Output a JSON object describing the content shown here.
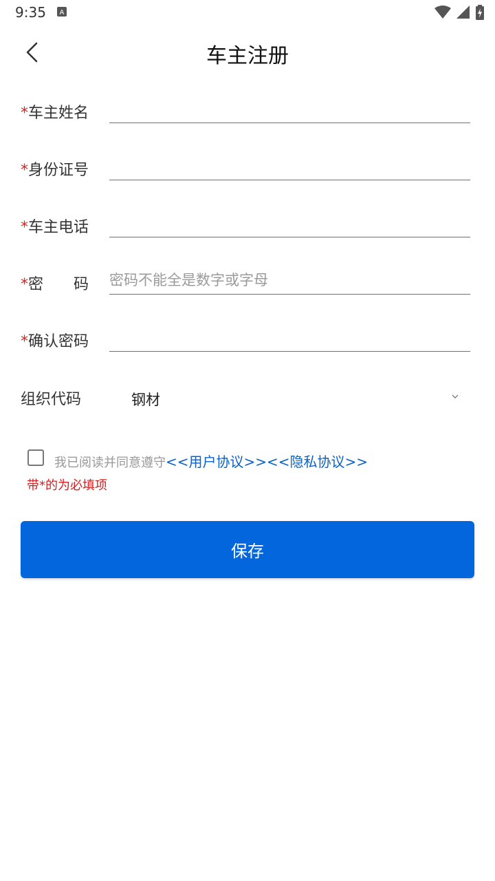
{
  "status_bar": {
    "time": "9:35"
  },
  "header": {
    "title": "车主注册",
    "back_icon": "chevron-left-icon"
  },
  "form": {
    "required_mark": "*",
    "fields": [
      {
        "label": "车主姓名",
        "value": "",
        "placeholder": ""
      },
      {
        "label": "身份证号",
        "value": "",
        "placeholder": ""
      },
      {
        "label": "车主电话",
        "value": "",
        "placeholder": ""
      },
      {
        "label": "密　　码",
        "value": "",
        "placeholder": "密码不能全是数字或字母"
      },
      {
        "label": "确认密码",
        "value": "",
        "placeholder": ""
      }
    ],
    "org_code": {
      "label": "组织代码",
      "value": "钢材"
    }
  },
  "agreement": {
    "text": "我已阅读并同意遵守",
    "user_link": "<<用户协议>>",
    "privacy_link": "<<隐私协议>>",
    "checked": false
  },
  "required_note": "带*的为必填项",
  "save_label": "保存",
  "colors": {
    "accent": "#0466dd",
    "link": "#0b62c4",
    "required": "#e02020"
  }
}
